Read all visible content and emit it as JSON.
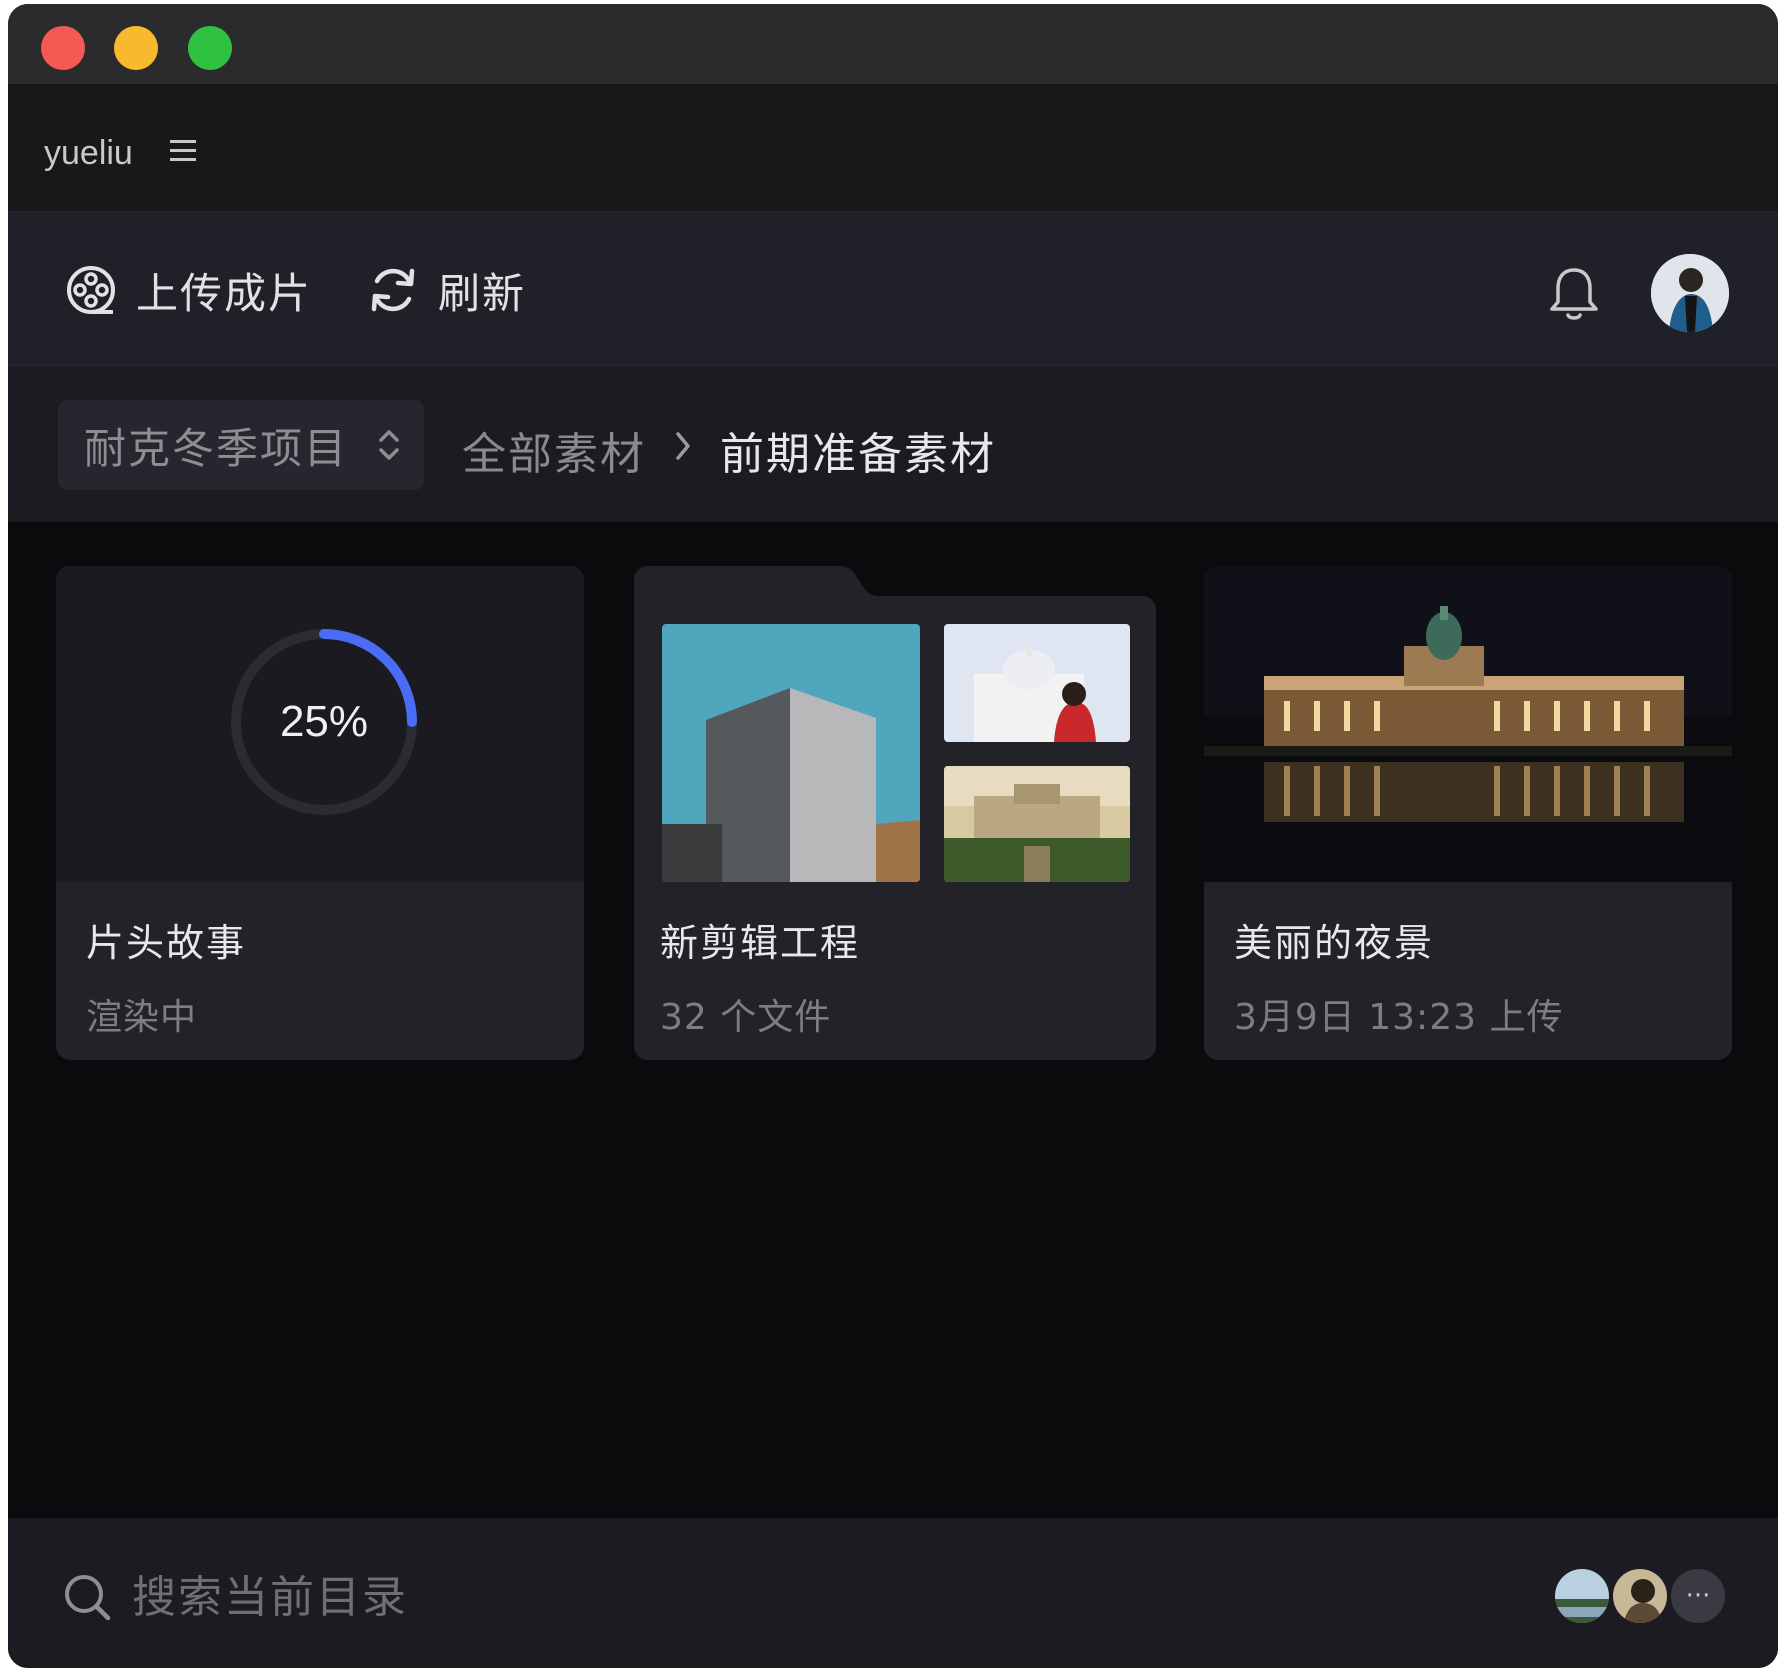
{
  "account": {
    "username": "yueliu"
  },
  "toolbar": {
    "upload_label": "上传成片",
    "refresh_label": "刷新"
  },
  "breadcrumb": {
    "project": "耐克冬季项目",
    "root": "全部素材",
    "current": "前期准备素材"
  },
  "cards": [
    {
      "title": "片头故事",
      "subtitle": "渲染中",
      "progress_text": "25%",
      "progress": 0.25,
      "kind": "rendering"
    },
    {
      "title": "新剪辑工程",
      "subtitle": "32 个文件",
      "kind": "folder"
    },
    {
      "title": "美丽的夜景",
      "subtitle": "3月9日 13:23 上传",
      "kind": "image"
    }
  ],
  "search": {
    "placeholder": "搜索当前目录",
    "value": ""
  },
  "collaborators": {
    "more_label": "···"
  },
  "colors": {
    "accent": "#4a6cf7",
    "window_bg": "#0b0b0e",
    "card_bg": "#222228",
    "title_bar": "#2b2b2e"
  },
  "icons": [
    "menu-icon",
    "film-reel-icon",
    "refresh-icon",
    "bell-icon",
    "chevron-updown-icon",
    "chevron-right-icon",
    "search-icon"
  ]
}
